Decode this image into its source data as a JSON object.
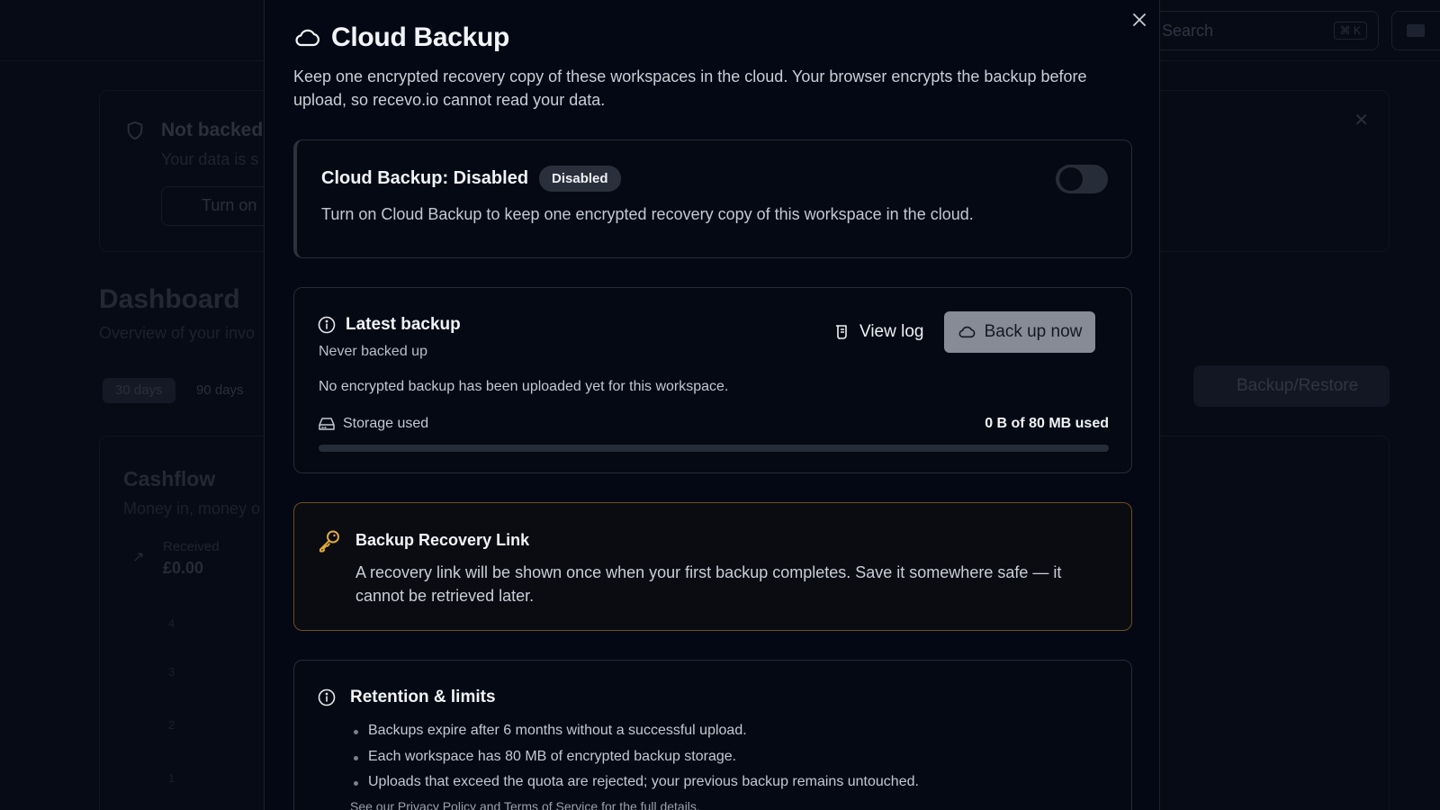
{
  "background": {
    "search_placeholder": "Search",
    "search_shortcut": "⌘ K",
    "banner_title": "Not backed",
    "banner_sub": "Your data is s",
    "banner_button": "Turn on",
    "dashboard_title": "Dashboard",
    "dashboard_sub": "Overview of your invo",
    "range_30": "30 days",
    "range_90": "90 days",
    "backup_restore": "Backup/Restore",
    "cashflow_title": "Cashflow",
    "cashflow_sub": "Money in, money o",
    "received_label": "Received",
    "received_value": "£0.00",
    "axis_ticks": [
      "4",
      "3",
      "2",
      "1"
    ]
  },
  "modal": {
    "title": "Cloud Backup",
    "description": "Keep one encrypted recovery copy of these workspaces in the cloud. Your browser encrypts the backup before upload, so recevo.io cannot read your data.",
    "status": {
      "label": "Cloud Backup: Disabled",
      "badge": "Disabled",
      "description": "Turn on Cloud Backup to keep one encrypted recovery copy of this workspace in the cloud.",
      "toggle_on": false
    },
    "latest": {
      "label": "Latest backup",
      "state": "Never backed up",
      "message": "No encrypted backup has been uploaded yet for this workspace.",
      "view_log": "View log",
      "backup_now": "Back up now",
      "storage_label": "Storage used",
      "storage_value": "0 B of 80 MB used",
      "storage_fraction": 0
    },
    "recovery": {
      "label": "Backup Recovery Link",
      "description": "A recovery link will be shown once when your first backup completes. Save it somewhere safe — it cannot be retrieved later."
    },
    "retention": {
      "label": "Retention & limits",
      "items": [
        "Backups expire after 6 months without a successful upload.",
        "Each workspace has 80 MB of encrypted backup storage.",
        "Uploads that exceed the quota are rejected; your previous backup remains untouched."
      ],
      "footer": "See our Privacy Policy and Terms of Service for the full details."
    }
  },
  "colors": {
    "background": "#070b16",
    "modal": "#040814",
    "recovery_border": "#6b5018",
    "key_icon": "#e0a93a",
    "button": "#868b96"
  },
  "icons": {
    "title": "cloud-icon",
    "close": "close-icon",
    "latest": "info-icon",
    "view_log": "log-icon",
    "backup": "cloud-icon",
    "storage": "hard-drive-icon",
    "recovery": "key-icon",
    "retention": "info-icon"
  }
}
